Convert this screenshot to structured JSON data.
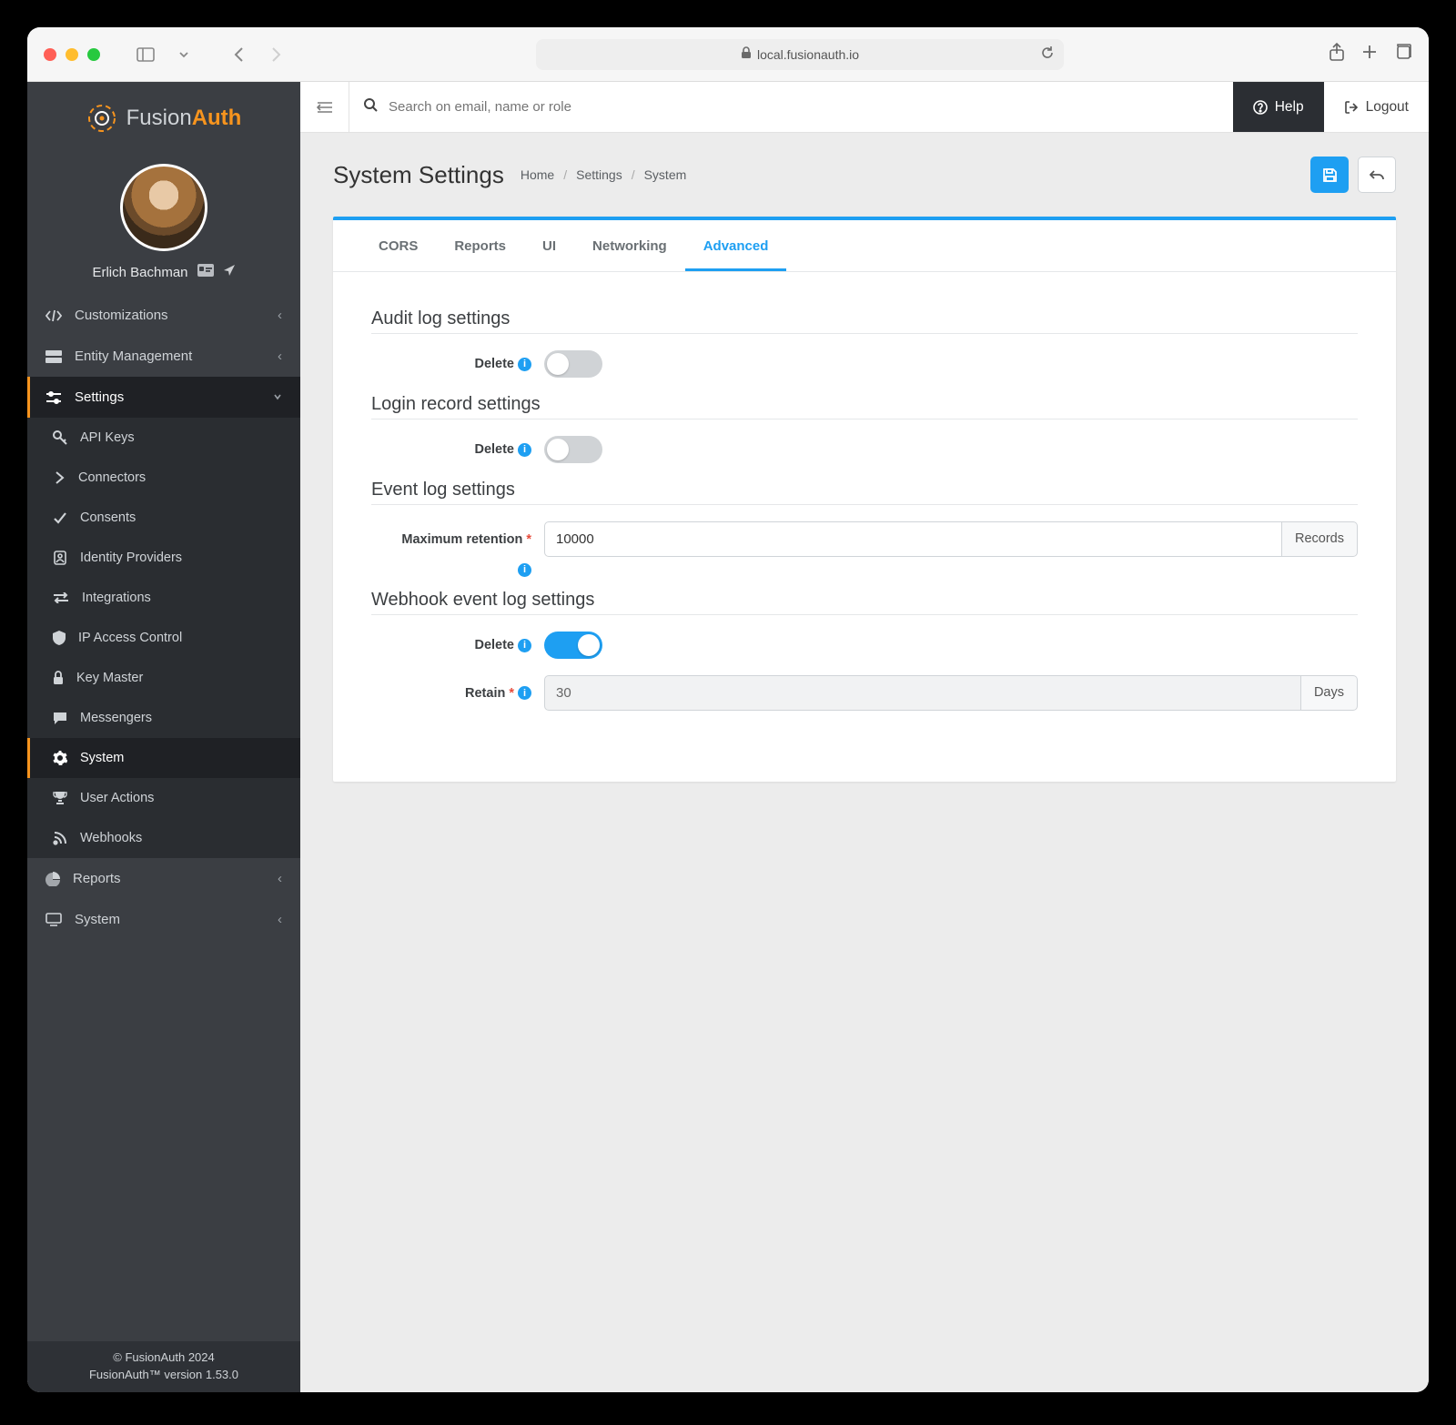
{
  "browser": {
    "url": "local.fusionauth.io"
  },
  "brand": {
    "part1": "Fusion",
    "part2": "Auth"
  },
  "user": {
    "name": "Erlich Bachman"
  },
  "nav": {
    "customizations": "Customizations",
    "entity_management": "Entity Management",
    "settings": "Settings",
    "settings_children": {
      "api_keys": "API Keys",
      "connectors": "Connectors",
      "consents": "Consents",
      "identity_providers": "Identity Providers",
      "integrations": "Integrations",
      "ip_access_control": "IP Access Control",
      "key_master": "Key Master",
      "messengers": "Messengers",
      "system": "System",
      "user_actions": "User Actions",
      "webhooks": "Webhooks"
    },
    "reports": "Reports",
    "system": "System"
  },
  "footer": {
    "copyright": "© FusionAuth 2024",
    "version": "FusionAuth™ version 1.53.0"
  },
  "topbar": {
    "search_placeholder": "Search on email, name or role",
    "help": "Help",
    "logout": "Logout"
  },
  "page": {
    "title": "System Settings",
    "crumbs": {
      "home": "Home",
      "settings": "Settings",
      "system": "System"
    }
  },
  "tabs": {
    "cors": "CORS",
    "reports": "Reports",
    "ui": "UI",
    "networking": "Networking",
    "advanced": "Advanced"
  },
  "sections": {
    "audit": {
      "heading": "Audit log settings",
      "delete_label": "Delete",
      "delete_on": false
    },
    "login": {
      "heading": "Login record settings",
      "delete_label": "Delete",
      "delete_on": false
    },
    "event": {
      "heading": "Event log settings",
      "retention_label": "Maximum retention",
      "retention_value": "10000",
      "retention_unit": "Records"
    },
    "webhook": {
      "heading": "Webhook event log settings",
      "delete_label": "Delete",
      "delete_on": true,
      "retain_label": "Retain",
      "retain_value": "30",
      "retain_unit": "Days"
    }
  },
  "colors": {
    "accent": "#1e9ff2",
    "orange": "#f7941e",
    "sidebar": "#3b3e43"
  }
}
